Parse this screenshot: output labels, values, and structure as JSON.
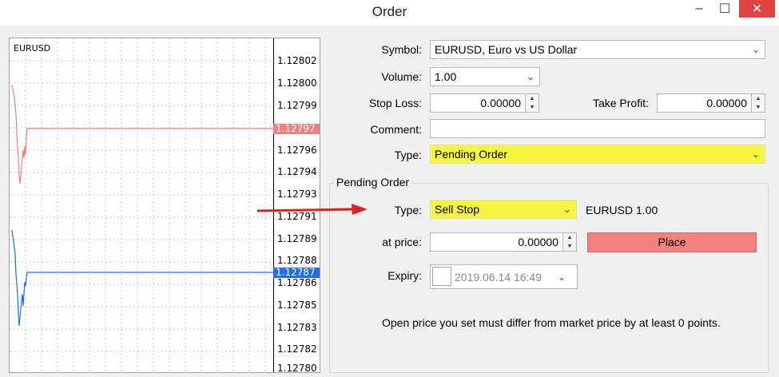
{
  "window": {
    "title": "Order",
    "minimize": "–",
    "maximize": "☐",
    "close": "✕"
  },
  "chart": {
    "symbol": "EURUSD",
    "ticks": [
      "1.12802",
      "1.12800",
      "1.12799",
      "1.12796",
      "1.12794",
      "1.12793",
      "1.12791",
      "1.12789",
      "1.12788",
      "1.12786",
      "1.12785",
      "1.12783",
      "1.12782",
      "1.12780"
    ],
    "ask_tag": "1.12797",
    "bid_tag": "1.12787",
    "ask_color": "#f08080",
    "bid_color": "#1f6fe0"
  },
  "form": {
    "symbol_label": "Symbol:",
    "symbol_value": "EURUSD, Euro vs US Dollar",
    "volume_label": "Volume:",
    "volume_value": "1.00",
    "stop_loss_label": "Stop Loss:",
    "stop_loss_value": "0.00000",
    "take_profit_label": "Take Profit:",
    "take_profit_value": "0.00000",
    "comment_label": "Comment:",
    "comment_value": "",
    "type_label": "Type:",
    "type_value": "Pending Order"
  },
  "pending": {
    "group_title": "Pending Order",
    "type_label": "Type:",
    "type_value": "Sell Stop",
    "instrument_summary": "EURUSD 1.00",
    "price_label": "at price:",
    "price_value": "0.00000",
    "place_label": "Place",
    "expiry_label": "Expiry:",
    "expiry_value": "2019.06.14 16:49",
    "note": "Open price you set must differ from market price by at least 0 points."
  },
  "annotation": {
    "arrow_color": "#e02020"
  }
}
